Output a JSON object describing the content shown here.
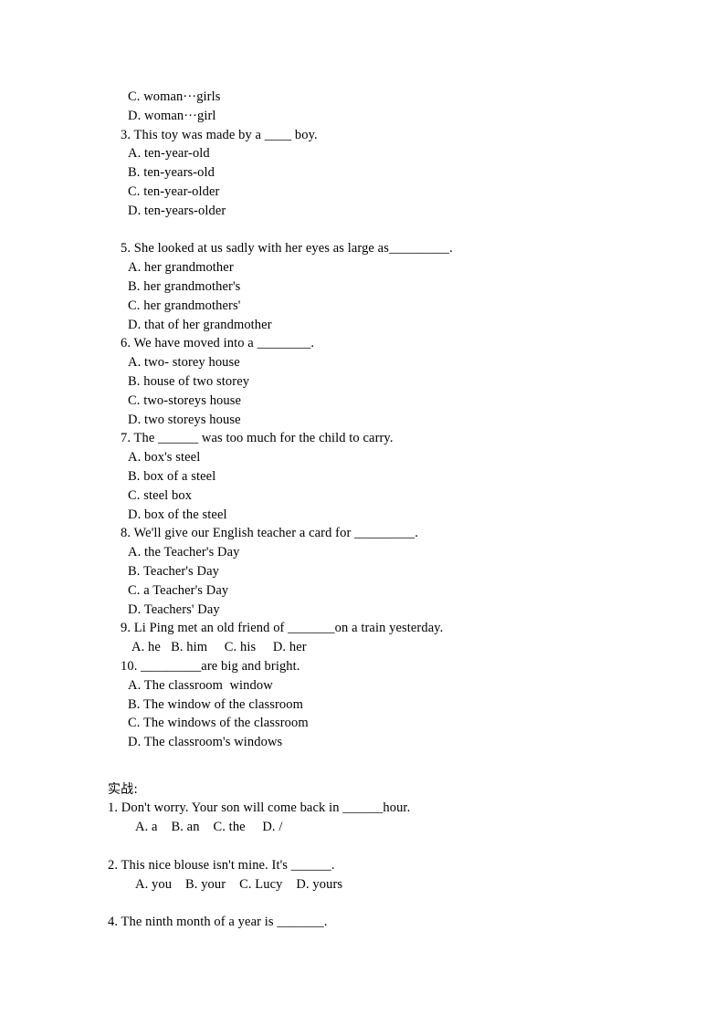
{
  "document": {
    "section_1": {
      "items": [
        {
          "type": "option",
          "text": "C. woman···girls"
        },
        {
          "type": "option",
          "text": "D. woman···girl"
        },
        {
          "type": "question",
          "text": "3. This toy was made by a ____ boy."
        },
        {
          "type": "option",
          "text": "A. ten-year-old"
        },
        {
          "type": "option",
          "text": "B. ten-years-old"
        },
        {
          "type": "option",
          "text": "C. ten-year-older"
        },
        {
          "type": "option",
          "text": "D. ten-years-older"
        },
        {
          "type": "gap",
          "text": ""
        },
        {
          "type": "question",
          "text": "5. She looked at us sadly with her eyes as large as_________."
        },
        {
          "type": "option",
          "text": "A. her grandmother"
        },
        {
          "type": "option",
          "text": "B. her grandmother's"
        },
        {
          "type": "option",
          "text": "C. her grandmothers'"
        },
        {
          "type": "option",
          "text": "D. that of her grandmother"
        },
        {
          "type": "question",
          "text": "6. We have moved into a ________."
        },
        {
          "type": "option",
          "text": "A. two- storey house"
        },
        {
          "type": "option",
          "text": "B. house of two storey"
        },
        {
          "type": "option",
          "text": "C. two-storeys house"
        },
        {
          "type": "option",
          "text": "D. two storeys house"
        },
        {
          "type": "question",
          "text": "7. The ______ was too much for the child to carry."
        },
        {
          "type": "option",
          "text": "A. box's steel"
        },
        {
          "type": "option",
          "text": "B. box of a steel"
        },
        {
          "type": "option",
          "text": "C. steel box"
        },
        {
          "type": "option",
          "text": "D. box of the steel"
        },
        {
          "type": "question",
          "text": "8. We'll give our English teacher a card for _________."
        },
        {
          "type": "option",
          "text": "A. the Teacher's Day"
        },
        {
          "type": "option",
          "text": "B. Teacher's Day"
        },
        {
          "type": "option",
          "text": "C. a Teacher's Day"
        },
        {
          "type": "option",
          "text": "D. Teachers' Day"
        },
        {
          "type": "question",
          "text": "9. Li Ping met an old friend of _______on a train yesterday."
        },
        {
          "type": "option-inline",
          "text": "A. he   B. him     C. his     D. her"
        },
        {
          "type": "question",
          "text": "10. _________are big and bright."
        },
        {
          "type": "option",
          "text": "A. The classroom  window"
        },
        {
          "type": "option",
          "text": "B. The window of the classroom"
        },
        {
          "type": "option",
          "text": "C. The windows of the classroom"
        },
        {
          "type": "option",
          "text": "D. The classroom's windows"
        }
      ]
    },
    "section_2": {
      "heading": "实战:",
      "items": [
        {
          "type": "question2",
          "text": "1. Don't worry. Your son will come back in ______hour."
        },
        {
          "type": "option2",
          "text": "A. a    B. an    C. the     D. /"
        },
        {
          "type": "gap",
          "text": ""
        },
        {
          "type": "question2",
          "text": "2. This nice blouse isn't mine. It's ______."
        },
        {
          "type": "option2",
          "text": "A. you    B. your    C. Lucy    D. yours"
        },
        {
          "type": "gap",
          "text": ""
        },
        {
          "type": "question2",
          "text": "4. The ninth month of a year is _______."
        }
      ]
    }
  }
}
